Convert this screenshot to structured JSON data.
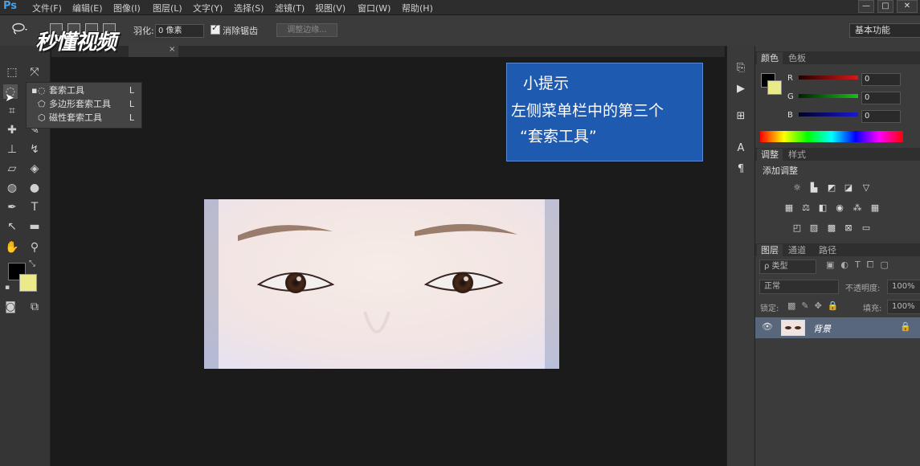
{
  "app": {
    "logo": "Ps"
  },
  "menubar": {
    "items": [
      "文件(F)",
      "编辑(E)",
      "图像(I)",
      "图层(L)",
      "文字(Y)",
      "选择(S)",
      "滤镜(T)",
      "视图(V)",
      "窗口(W)",
      "帮助(H)"
    ],
    "window_controls": [
      "—",
      "□",
      "✕"
    ]
  },
  "options_bar": {
    "feather_label": "羽化:",
    "feather_value": "0 像素",
    "antialias_label": "消除锯齿",
    "antialias_checked": true,
    "refine_edge_label": "调整边缘...",
    "workspace_value": "基本功能"
  },
  "watermark": {
    "text": "秒懂视频"
  },
  "document": {
    "tab_close": "×"
  },
  "lasso_flyout": {
    "items": [
      {
        "label": "套索工具",
        "shortcut": "L",
        "icon": "lasso-icon",
        "selected": true
      },
      {
        "label": "多边形套索工具",
        "shortcut": "L",
        "icon": "polygonal-lasso-icon",
        "selected": false
      },
      {
        "label": "磁性套索工具",
        "shortcut": "L",
        "icon": "magnetic-lasso-icon",
        "selected": false
      }
    ]
  },
  "tip": {
    "title": "小提示",
    "line1": "左侧菜单栏中的第三个",
    "line2": "“套索工具”",
    "color": "#1e5ab0"
  },
  "color_panel": {
    "tabs": [
      "颜色",
      "色板"
    ],
    "channels": [
      {
        "label": "R",
        "value": "0",
        "color": "#d81818"
      },
      {
        "label": "G",
        "value": "0",
        "color": "#18c018"
      },
      {
        "label": "B",
        "value": "0",
        "color": "#1818d8"
      }
    ],
    "foreground": "#000000",
    "background": "#eaea8a"
  },
  "adjust_panel": {
    "tabs": [
      "调整",
      "样式"
    ],
    "heading": "添加调整"
  },
  "layers_panel": {
    "tabs": [
      "图层",
      "通道",
      "路径"
    ],
    "filter_label": "ρ 类型",
    "blend_mode": "正常",
    "opacity_label": "不透明度:",
    "opacity_value": "100%",
    "lock_label": "锁定:",
    "fill_label": "填充:",
    "fill_value": "100%",
    "layer_name": "背景"
  }
}
